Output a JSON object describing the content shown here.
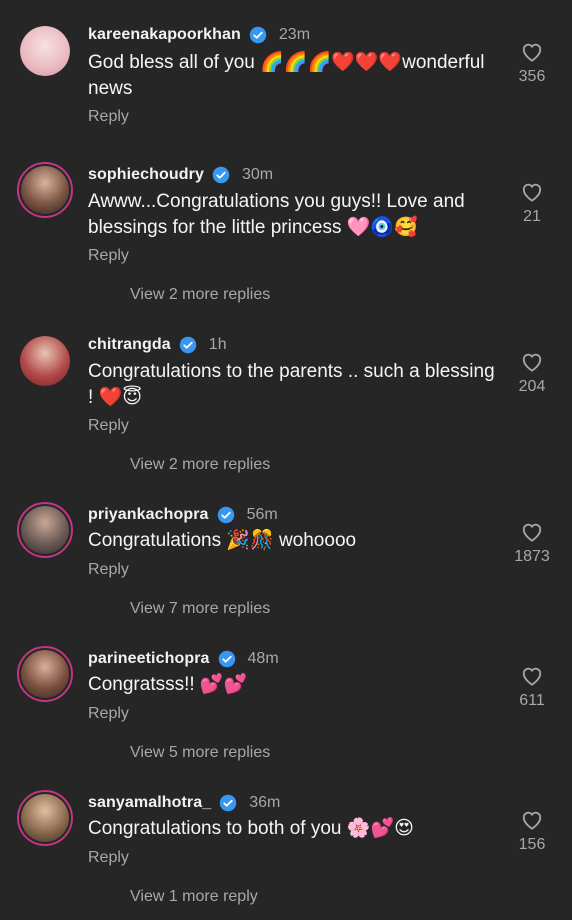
{
  "comments": [
    {
      "username": "kareenakapoorkhan",
      "time": "23m",
      "text": "God bless all of you 🌈🌈🌈❤️❤️❤️wonderful news",
      "reply": "Reply",
      "likes": "356",
      "more": "",
      "avatar_color": "#f3d0d6"
    },
    {
      "username": "sophiechoudry",
      "time": "30m",
      "text": "Awww...Congratulations you guys!! Love and blessings for the little princess 🩷🧿🥰",
      "reply": "Reply",
      "likes": "21",
      "more": "View 2 more replies",
      "avatar_color": "#5a3b2e"
    },
    {
      "username": "chitrangda",
      "time": "1h",
      "text": "Congratulations to the parents .. such a blessing ! ❤️😇",
      "reply": "Reply",
      "likes": "204",
      "more": "View 2 more replies",
      "avatar_color": "#b23a3a"
    },
    {
      "username": "priyankachopra",
      "time": "56m",
      "text": "Congratulations 🎉🎊 wohoooo",
      "reply": "Reply",
      "likes": "1873",
      "more": "View 7 more replies",
      "avatar_color": "#6b5a55"
    },
    {
      "username": "parineetichopra",
      "time": "48m",
      "text": "Congratsss!! 💕💕",
      "reply": "Reply",
      "likes": "611",
      "more": "View 5 more replies",
      "avatar_color": "#7a4f3f"
    },
    {
      "username": "sanyamalhotra_",
      "time": "36m",
      "text": "Congratulations to both of you 🌸💕😍",
      "reply": "Reply",
      "likes": "156",
      "more": "View 1 more reply",
      "avatar_color": "#8a6a4f"
    }
  ],
  "colors": {
    "background": "#262626",
    "verified": "#3897f0",
    "ring": "#c13584",
    "muted": "#a8a8a8"
  }
}
